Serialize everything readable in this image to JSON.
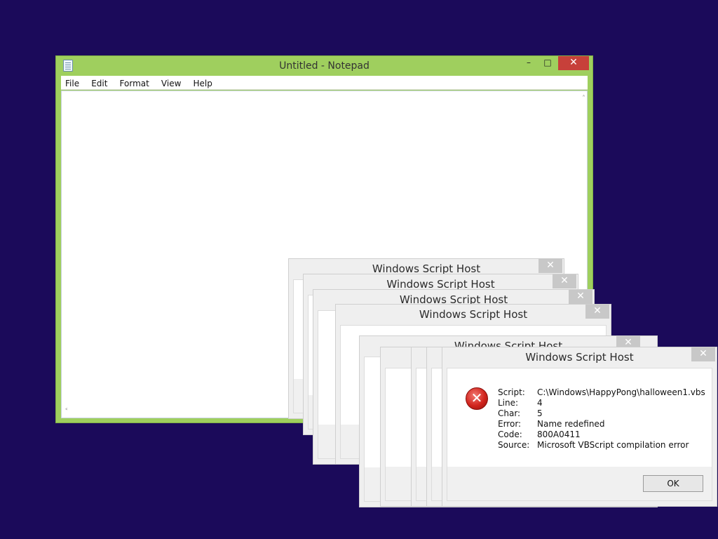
{
  "notepad": {
    "title": "Untitled - Notepad",
    "minimize": "–",
    "maximize": "□",
    "close": "✕",
    "menu": [
      "File",
      "Edit",
      "Format",
      "View",
      "Help"
    ],
    "scroll_up": "˄",
    "scroll_left": "˂"
  },
  "dialogs": [
    {
      "title": "Windows Script Host",
      "close": "✕"
    },
    {
      "title": "Windows Script Host",
      "close": "✕"
    },
    {
      "title": "Windows Script Host",
      "close": "✕"
    },
    {
      "title": "Windows Script Host",
      "close": "✕"
    },
    {
      "title": "Windows Script Host",
      "close": "✕"
    },
    {
      "title": "Windows Script Host",
      "close": "✕"
    }
  ],
  "error": {
    "icon": "error-icon",
    "icon_glyph": "✕",
    "fields": [
      {
        "label": "Script:",
        "value": "C:\\Windows\\HappyPong\\halloween1.vbs"
      },
      {
        "label": "Line:",
        "value": "4"
      },
      {
        "label": "Char:",
        "value": "5"
      },
      {
        "label": "Error:",
        "value": "Name redefined"
      },
      {
        "label": "Code:",
        "value": "800A0411"
      },
      {
        "label": "Source:",
        "value": "Microsoft VBScript compilation error"
      }
    ],
    "ok_label": "OK"
  },
  "colors": {
    "desktop": "#1b0a5a",
    "notepad_frame": "#9fcf5e",
    "close_red": "#c7403a"
  }
}
